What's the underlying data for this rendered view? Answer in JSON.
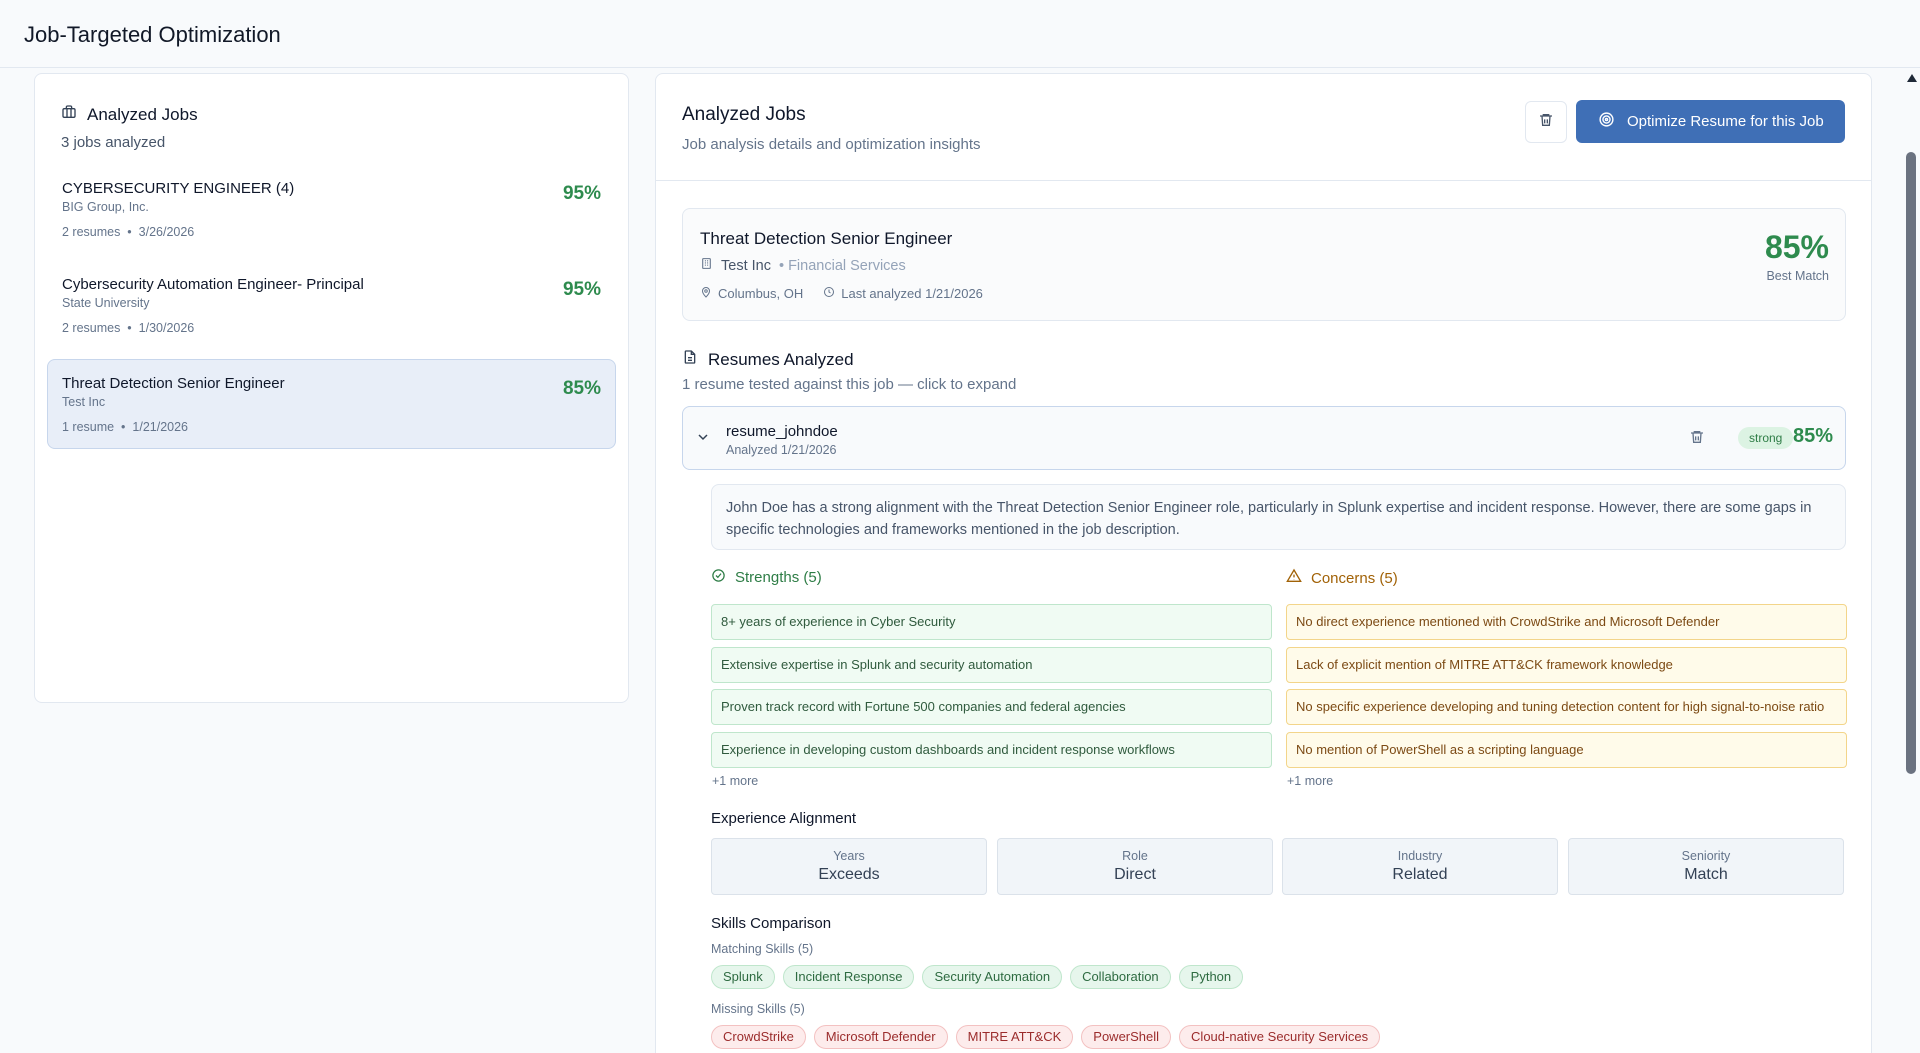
{
  "app": {
    "title": "Job-Targeted Optimization"
  },
  "left": {
    "heading": "Analyzed Jobs",
    "count_text": "3 jobs analyzed",
    "jobs": [
      {
        "title": "CYBERSECURITY ENGINEER (4)",
        "company": "BIG Group, Inc.",
        "resumes": "2 resumes",
        "date": "3/26/2026",
        "score": "95%"
      },
      {
        "title": "Cybersecurity Automation Engineer- Principal",
        "company": "State University",
        "resumes": "2 resumes",
        "date": "1/30/2026",
        "score": "95%"
      },
      {
        "title": "Threat Detection Senior Engineer",
        "company": "Test Inc",
        "resumes": "1 resume",
        "date": "1/21/2026",
        "score": "85%"
      }
    ]
  },
  "right": {
    "title": "Analyzed Jobs",
    "subtitle": "Job analysis details and optimization insights",
    "optimize_label": "Optimize Resume for this Job",
    "job": {
      "title": "Threat Detection Senior Engineer",
      "company": "Test Inc",
      "industry": "• Financial Services",
      "location": "Columbus, OH",
      "last_analyzed": "Last analyzed 1/21/2026",
      "score": "85%",
      "score_label": "Best Match"
    },
    "resumes_heading": "Resumes Analyzed",
    "resumes_sub": "1 resume tested against this job — click to expand",
    "resume": {
      "name": "resume_johndoe",
      "date": "Analyzed 1/21/2026",
      "badge": "strong",
      "score": "85%",
      "summary": "John Doe has a strong alignment with the Threat Detection Senior Engineer role, particularly in Splunk expertise and incident response. However, there are some gaps in specific technologies and frameworks mentioned in the job description.",
      "strengths_heading": "Strengths (5)",
      "strengths": [
        "8+ years of experience in Cyber Security",
        "Extensive expertise in Splunk and security automation",
        "Proven track record with Fortune 500 companies and federal agencies",
        "Experience in developing custom dashboards and incident response workflows"
      ],
      "strengths_more": "+1 more",
      "concerns_heading": "Concerns (5)",
      "concerns": [
        "No direct experience mentioned with CrowdStrike and Microsoft Defender",
        "Lack of explicit mention of MITRE ATT&CK framework knowledge",
        "No specific experience developing and tuning detection content for high signal-to-noise ratio",
        "No mention of PowerShell as a scripting language"
      ],
      "concerns_more": "+1 more",
      "experience_heading": "Experience Alignment",
      "experience": [
        {
          "label": "Years",
          "value": "Exceeds"
        },
        {
          "label": "Role",
          "value": "Direct"
        },
        {
          "label": "Industry",
          "value": "Related"
        },
        {
          "label": "Seniority",
          "value": "Match"
        }
      ],
      "skills_heading": "Skills Comparison",
      "matching_label": "Matching Skills (5)",
      "matching": [
        "Splunk",
        "Incident Response",
        "Security Automation",
        "Collaboration",
        "Python"
      ],
      "missing_label": "Missing Skills (5)",
      "missing": [
        "CrowdStrike",
        "Microsoft Defender",
        "MITRE ATT&CK",
        "PowerShell",
        "Cloud-native Security Services"
      ]
    }
  },
  "colors": {
    "accent": "#3f6fb6",
    "success": "#2e8b4e",
    "warning": "#a16207",
    "danger": "#9b2c2c"
  }
}
